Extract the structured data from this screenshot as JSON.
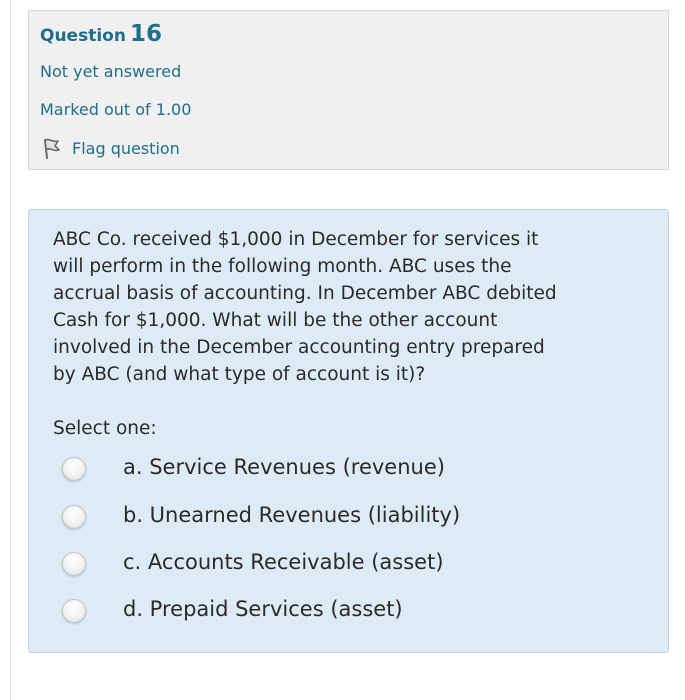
{
  "question_info": {
    "label": "Question",
    "number": "16",
    "status": "Not yet answered",
    "marks": "Marked out of 1.00",
    "flag_label": "Flag question"
  },
  "question": {
    "text_lines": [
      "ABC Co. received $1,000 in December for services it",
      "will perform in the following month. ABC uses the",
      "accrual basis of accounting. In December ABC debited",
      "Cash for $1,000. What will be the other account",
      "involved in the December accounting entry prepared",
      "by ABC (and what type of account is it)?"
    ],
    "prompt": "Select one:",
    "options": [
      {
        "label": "a. Service Revenues (revenue)",
        "selected": false
      },
      {
        "label": "b. Unearned Revenues (liability)",
        "selected": false
      },
      {
        "label": "c. Accounts Receivable (asset)",
        "selected": false
      },
      {
        "label": "d. Prepaid Services (asset)",
        "selected": false
      }
    ]
  },
  "colors": {
    "accent": "#1e6e8c",
    "info_background": "#f0f0f0",
    "question_background": "#dcebf6"
  },
  "icons": {
    "flag": "flag-icon",
    "radio": "radio-button"
  }
}
